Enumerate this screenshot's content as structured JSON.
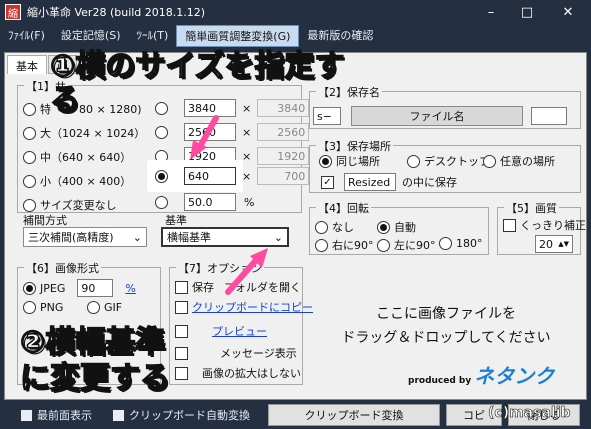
{
  "window": {
    "title": "縮小革命 Ver28 (build 2018.1.12)",
    "icon_char": "縮",
    "min": "–",
    "max": "□",
    "close": "✕"
  },
  "menu": [
    "ﾌｧｲﾙ(F)",
    "設定記憶(S)",
    "ﾂｰﾙ(T)",
    "簡単画質調整変換(G)",
    "最新版の確認"
  ],
  "tabs": [
    "基本",
    "画"
  ],
  "size_group": {
    "label": "【1】サ",
    "options": [
      {
        "label": "特",
        "value": "80 × 1280)"
      },
      {
        "label": "大（1024 × 1024）"
      },
      {
        "label": "中（640 × 640）"
      },
      {
        "label": "小（400 × 400）"
      },
      {
        "label": "サイズ変更なし"
      }
    ],
    "widths": [
      "3840",
      "2560",
      "1920",
      "640"
    ],
    "heights": [
      "3840",
      "2560",
      "1920",
      "700"
    ],
    "times": "×",
    "percent_value": "50.0",
    "percent": "%"
  },
  "interp": {
    "label": "補間方式",
    "value": "三次補間(高精度)"
  },
  "basis": {
    "label": "基準",
    "value": "横幅基準"
  },
  "save_name": {
    "label": "【2】保存名",
    "prefix": "s−",
    "filename": "ファイル名"
  },
  "save_loc": {
    "label": "【3】保存場所",
    "options": [
      "同じ場所",
      "デスクトップ",
      "任意の場所"
    ],
    "folder": "Resized",
    "suffix": "の中に保存"
  },
  "rotate": {
    "label": "【4】回転",
    "options": [
      "なし",
      "自動",
      "右に90°",
      "左に90°",
      "180°"
    ]
  },
  "quality": {
    "label": "【5】画質",
    "sharpen": "くっきり補正",
    "value": "20"
  },
  "format": {
    "label": "【6】画像形式",
    "jpeg": "JPEG",
    "jpeg_q": "90",
    "pct": "%",
    "png": "PNG",
    "gif": "GIF"
  },
  "options": {
    "label": "【7】オプション",
    "items": [
      "保存",
      "クリップボードにコピー",
      "プレビュー",
      "メッセージ表示",
      "画像の拡大はしない"
    ],
    "item0_rest": "フォルダを開く"
  },
  "drop": {
    "line1": "ここに画像ファイルを",
    "line2": "ドラッグ＆ドロップしてください"
  },
  "logo": {
    "tag": "produced by",
    "name": "ネタンク"
  },
  "bottom": {
    "topmost": "最前面表示",
    "autoclip": "クリップボード自動変換",
    "clip_btn": "クリップボード変換",
    "copy_btn": "コピ",
    "close_btn": "閉じる",
    "watermark": "(c)masalib"
  },
  "annotations": {
    "a1_line1": "①横のサイズを指定す",
    "a1_line2": "る",
    "a2_line1": "②横幅基準",
    "a2_line2": "に変更する"
  },
  "colors": {
    "titlebar": "#243041",
    "annotation_arrow": "#ff4aa0",
    "link": "#1a42c8"
  }
}
